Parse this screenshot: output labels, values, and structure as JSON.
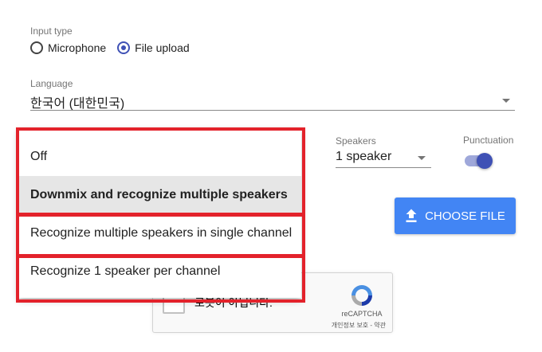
{
  "input_type": {
    "label": "Input type",
    "options": [
      {
        "label": "Microphone",
        "checked": false
      },
      {
        "label": "File upload",
        "checked": true
      }
    ]
  },
  "language": {
    "label": "Language",
    "value": "한국어 (대한민국)"
  },
  "speakers": {
    "label": "Speakers",
    "value": "1 speaker"
  },
  "punctuation": {
    "label": "Punctuation",
    "enabled": true
  },
  "upload": {
    "button_label": "CHOOSE FILE"
  },
  "multichannel_menu": {
    "items": [
      {
        "label": "Off",
        "selected": false
      },
      {
        "label": "Downmix and recognize multiple speakers",
        "selected": true
      },
      {
        "label": "Recognize multiple speakers in single channel",
        "selected": false
      },
      {
        "label": "Recognize 1 speaker per channel",
        "selected": false
      }
    ]
  },
  "recaptcha": {
    "checkbox_text": "로봇이 아닙니다.",
    "brand": "reCAPTCHA",
    "links": "개인정보 보호 - 약관"
  },
  "colors": {
    "accent": "#3f51b5",
    "button": "#4285f4",
    "highlight": "#e3222b",
    "selected_item_bg": "#e6e6e6"
  }
}
